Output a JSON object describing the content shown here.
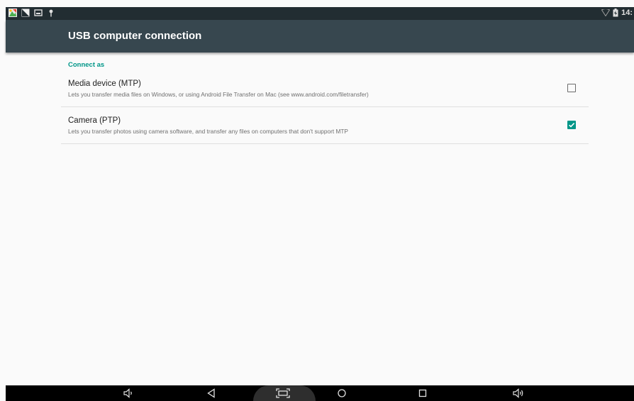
{
  "status_bar": {
    "left_icons": [
      "photos-icon",
      "image-icon",
      "gallery-icon",
      "usb-debug-icon"
    ],
    "wifi_icon": "wifi-icon",
    "battery_icon": "battery-icon",
    "time": "14:"
  },
  "app_bar": {
    "title": "USB computer connection"
  },
  "section": {
    "header": "Connect as"
  },
  "options": [
    {
      "title": "Media device (MTP)",
      "summary": "Lets you transfer media files on Windows, or using Android File Transfer on Mac (see www.android.com/filetransfer)",
      "checked": false
    },
    {
      "title": "Camera (PTP)",
      "summary": "Lets you transfer photos using camera software, and transfer any files on computers that don't support MTP",
      "checked": true
    }
  ],
  "nav_bar": {
    "icons": [
      "volume-down-icon",
      "back-icon",
      "screenshot-icon",
      "home-icon",
      "recents-icon",
      "volume-up-icon"
    ]
  },
  "colors": {
    "accent": "#009688",
    "app_bar": "#37474f",
    "status_bar": "#222d32",
    "background": "#fafafa"
  }
}
